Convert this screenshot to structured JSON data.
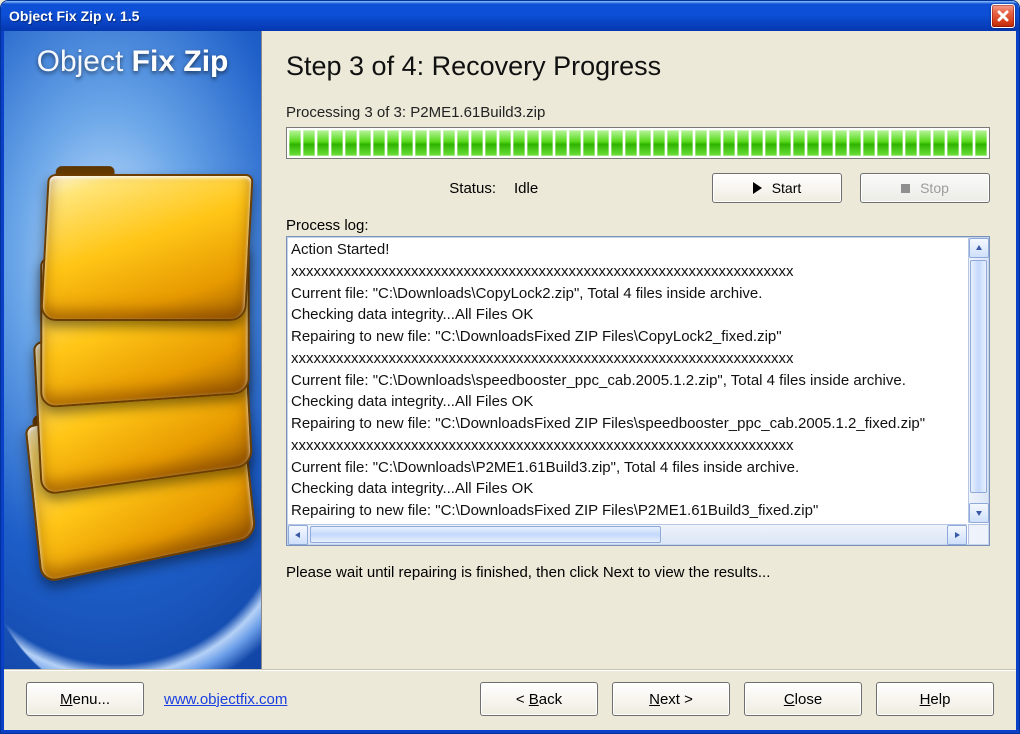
{
  "window": {
    "title": "Object Fix Zip v. 1.5"
  },
  "brand": {
    "word1": "Object",
    "word2": "Fix",
    "word3": "Zip"
  },
  "step": {
    "title": "Step 3 of 4: Recovery Progress",
    "processing": "Processing 3 of 3: P2ME1.61Build3.zip",
    "status_label": "Status:",
    "status_value": "Idle",
    "start_label": "Start",
    "stop_label": "Stop",
    "log_label": "Process log:",
    "hint": "Please wait until repairing is finished, then click Next to view the results..."
  },
  "log_lines": [
    "Action Started!",
    "xxxxxxxxxxxxxxxxxxxxxxxxxxxxxxxxxxxxxxxxxxxxxxxxxxxxxxxxxxxxxxxxxxx",
    "Current file: \"C:\\Downloads\\CopyLock2.zip\", Total 4 files inside archive.",
    "Checking data integrity...All Files OK",
    "Repairing to new file: \"C:\\DownloadsFixed ZIP Files\\CopyLock2_fixed.zip\"",
    "xxxxxxxxxxxxxxxxxxxxxxxxxxxxxxxxxxxxxxxxxxxxxxxxxxxxxxxxxxxxxxxxxxx",
    "Current file: \"C:\\Downloads\\speedbooster_ppc_cab.2005.1.2.zip\", Total 4 files inside archive.",
    "Checking data integrity...All Files OK",
    "Repairing to new file: \"C:\\DownloadsFixed ZIP Files\\speedbooster_ppc_cab.2005.1.2_fixed.zip\"",
    "xxxxxxxxxxxxxxxxxxxxxxxxxxxxxxxxxxxxxxxxxxxxxxxxxxxxxxxxxxxxxxxxxxx",
    "Current file: \"C:\\Downloads\\P2ME1.61Build3.zip\", Total 4 files inside archive.",
    "Checking data integrity...All Files OK",
    "Repairing to new file: \"C:\\DownloadsFixed ZIP Files\\P2ME1.61Build3_fixed.zip\""
  ],
  "footer": {
    "menu": "Menu...",
    "link": "www.objectfix.com",
    "back": "< Back",
    "next": "Next >",
    "close": "Close",
    "help": "Help"
  },
  "progress": {
    "segments": 50
  },
  "accel": {
    "menu_u": "M",
    "back_u": "B",
    "next_u": "N",
    "close_u": "C",
    "help_u": "H"
  }
}
